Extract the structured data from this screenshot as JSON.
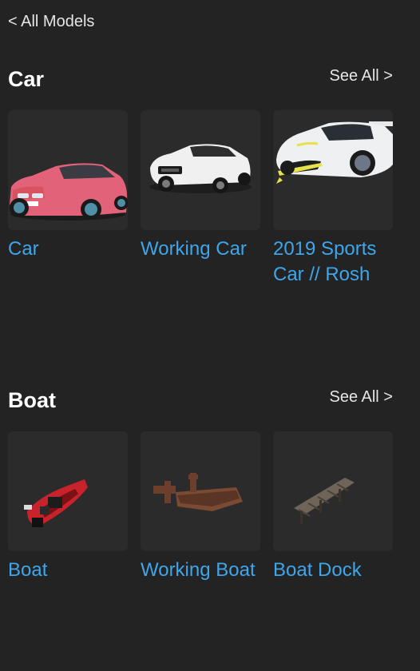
{
  "nav": {
    "back_label": "< All Models"
  },
  "sections": [
    {
      "title": "Car",
      "see_all": "See All >",
      "items": [
        {
          "name": "Car",
          "icon": "pink-suv-thumbnail"
        },
        {
          "name": "Working Car",
          "icon": "white-sports-car-thumbnail"
        },
        {
          "name": "2019 Sports Car // Rosh",
          "icon": "white-hypercar-thumbnail"
        }
      ]
    },
    {
      "title": "Boat",
      "see_all": "See All >",
      "items": [
        {
          "name": "Boat",
          "icon": "red-speedboat-thumbnail"
        },
        {
          "name": "Working Boat",
          "icon": "wooden-boat-thumbnail"
        },
        {
          "name": "Boat Dock",
          "icon": "wooden-dock-thumbnail"
        }
      ]
    }
  ],
  "colors": {
    "background": "#232323",
    "card": "#2b2b2b",
    "link": "#3ea6ea",
    "text": "#ffffff"
  }
}
